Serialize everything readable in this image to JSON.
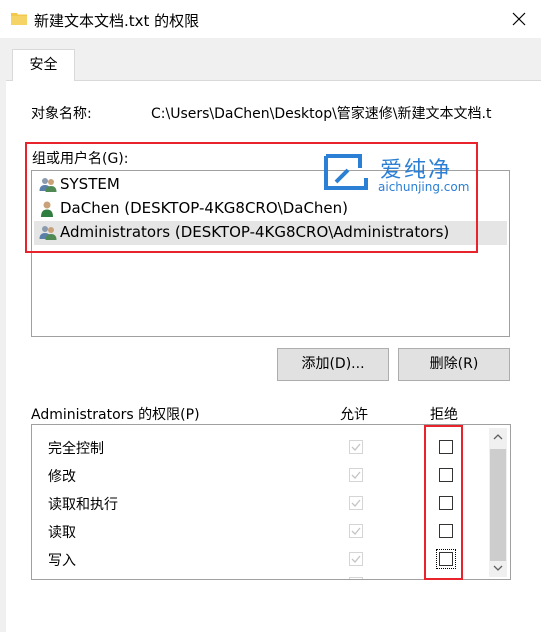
{
  "window": {
    "title": "新建文本文档.txt 的权限",
    "close_icon": "close-icon",
    "folder_icon": "folder-icon"
  },
  "tabs": [
    {
      "label": "安全",
      "selected": true
    }
  ],
  "object": {
    "label": "对象名称:",
    "path": "C:\\Users\\DaChen\\Desktop\\管家速修\\新建文本文档.t"
  },
  "groups": {
    "label": "组或用户名(G):",
    "items": [
      {
        "name": "SYSTEM",
        "icon": "users-group-icon",
        "selected": false
      },
      {
        "name": "DaChen (DESKTOP-4KG8CRO\\DaChen)",
        "icon": "user-icon",
        "selected": false
      },
      {
        "name": "Administrators (DESKTOP-4KG8CRO\\Administrators)",
        "icon": "users-group-icon",
        "selected": true
      }
    ]
  },
  "buttons": {
    "add": "添加(D)...",
    "remove": "删除(R)"
  },
  "permissions": {
    "label": "Administrators 的权限(P)",
    "allow_header": "允许",
    "deny_header": "拒绝",
    "rows": [
      {
        "name": "完全控制",
        "allow": true,
        "deny": false
      },
      {
        "name": "修改",
        "allow": true,
        "deny": false
      },
      {
        "name": "读取和执行",
        "allow": true,
        "deny": false
      },
      {
        "name": "读取",
        "allow": true,
        "deny": false
      },
      {
        "name": "写入",
        "allow": true,
        "deny": false
      }
    ]
  },
  "watermark": {
    "brand": "爱纯净",
    "url": "aichunjing.com"
  },
  "colors": {
    "highlight_red": "#e8232b",
    "watermark_blue": "#2b7fd4",
    "selection": "#e5e5e5"
  }
}
